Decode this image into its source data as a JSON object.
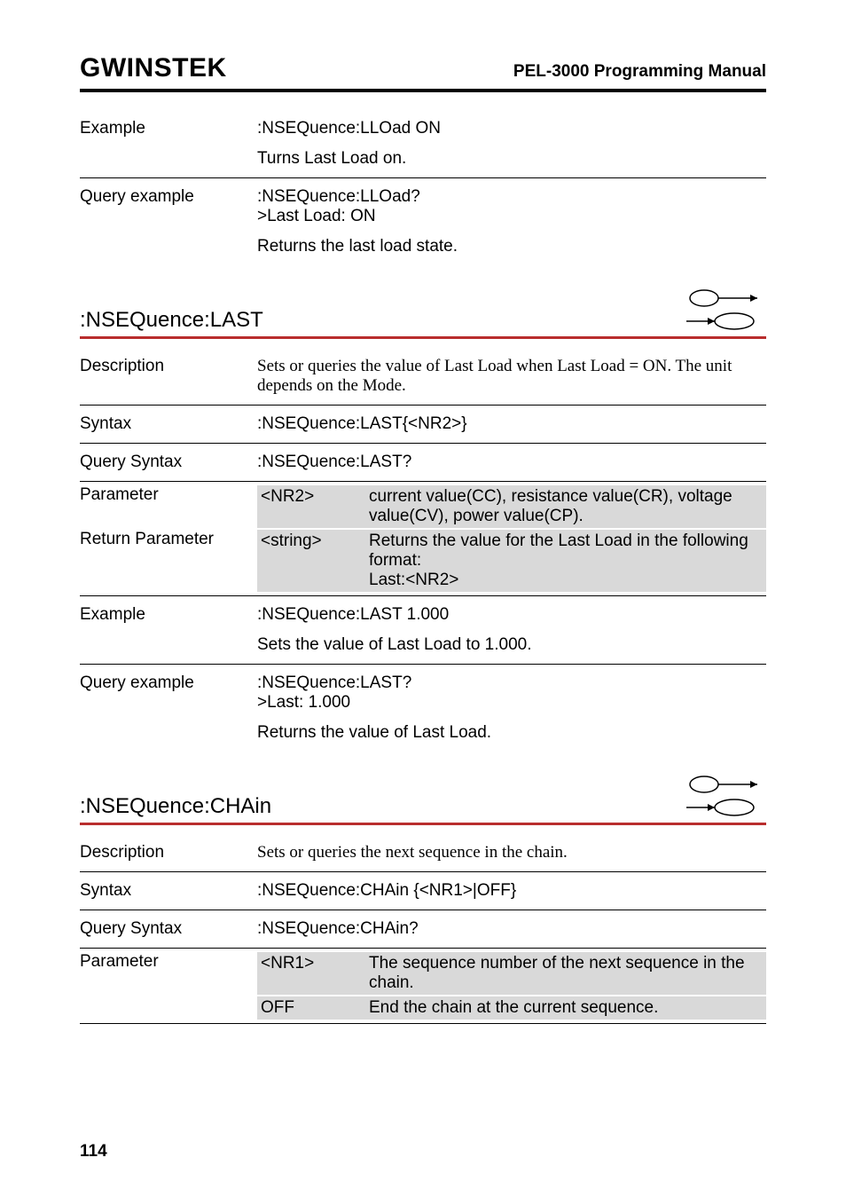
{
  "header": {
    "brand": "GWINSTEK",
    "manual_title": "PEL-3000 Programming Manual"
  },
  "block1": {
    "example_label": "Example",
    "example_cmd": ":NSEQuence:LLOad ON",
    "example_desc": "Turns Last Load on.",
    "query_label": "Query example",
    "query_cmd": ":NSEQuence:LLOad?",
    "query_resp": ">Last Load: ON",
    "query_desc": "Returns the last load state."
  },
  "sect_last": {
    "title": ":NSEQuence:LAST",
    "desc_label": "Description",
    "desc_text": "Sets or queries the value of Last Load when Last Load = ON.  The unit depends on the Mode.",
    "syntax_label": "Syntax",
    "syntax_val": ":NSEQuence:LAST{<NR2>}",
    "qsyntax_label": "Query Syntax",
    "qsyntax_val": ":NSEQuence:LAST?",
    "param_label": "Parameter",
    "param_code": "<NR2>",
    "param_desc": "current value(CC), resistance value(CR), voltage value(CV), power value(CP).",
    "ret_label": "Return Parameter",
    "ret_code": "<string>",
    "ret_desc": "Returns the value for the Last Load in the following format:\nLast:<NR2>",
    "example_label": "Example",
    "example_cmd": ":NSEQuence:LAST 1.000",
    "example_desc": "Sets the value of Last Load to 1.000.",
    "query_label": "Query example",
    "query_cmd": ":NSEQuence:LAST?",
    "query_resp": ">Last: 1.000",
    "query_desc": "Returns the value of Last Load."
  },
  "sect_chain": {
    "title": ":NSEQuence:CHAin",
    "desc_label": "Description",
    "desc_text": "Sets or queries the next sequence in the chain.",
    "syntax_label": "Syntax",
    "syntax_val": ":NSEQuence:CHAin {<NR1>|OFF}",
    "qsyntax_label": "Query Syntax",
    "qsyntax_val": ":NSEQuence:CHAin?",
    "param_label": "Parameter",
    "param1_code": "<NR1>",
    "param1_desc": "The sequence number of the next sequence in the chain.",
    "param2_code": "OFF",
    "param2_desc": "End the chain at the current sequence."
  },
  "page": "114"
}
